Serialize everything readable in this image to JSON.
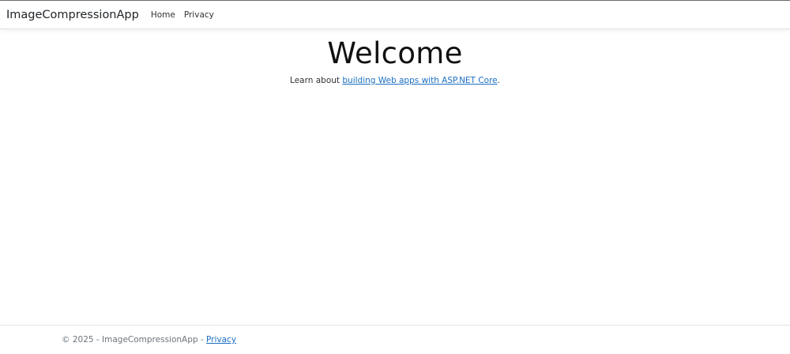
{
  "navbar": {
    "brand": "ImageCompressionApp",
    "links": [
      {
        "label": "Home"
      },
      {
        "label": "Privacy"
      }
    ]
  },
  "main": {
    "heading": "Welcome",
    "learn_prefix": "Learn about ",
    "learn_link": "building Web apps with ASP.NET Core",
    "learn_suffix": "."
  },
  "footer": {
    "prefix": "© 2025 - ImageCompressionApp - ",
    "privacy_link": "Privacy"
  },
  "colors": {
    "link": "#1b6ec2",
    "text": "#212529",
    "muted": "#6c757d"
  }
}
